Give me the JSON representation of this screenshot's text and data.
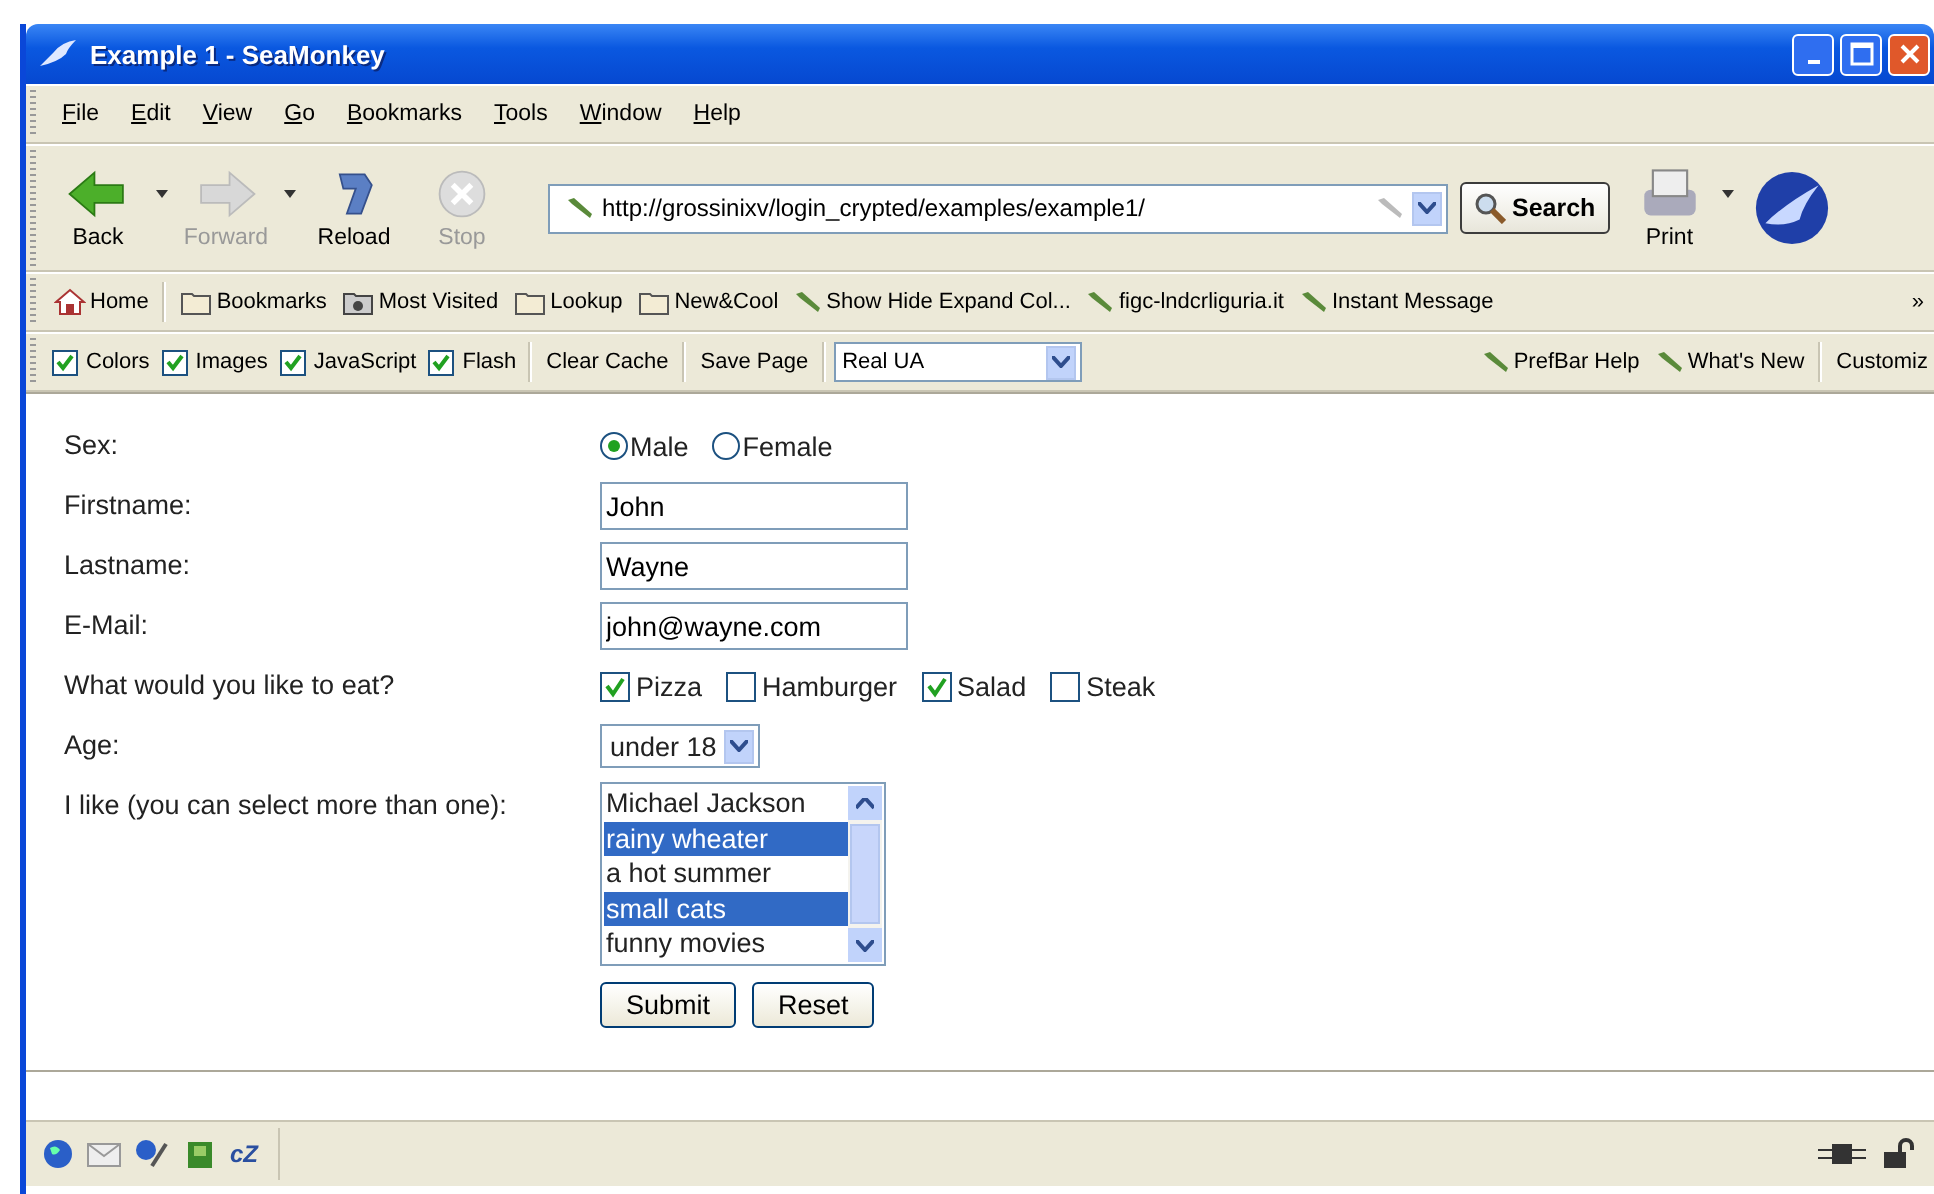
{
  "window": {
    "title": "Example 1 - SeaMonkey"
  },
  "menu": [
    "File",
    "Edit",
    "View",
    "Go",
    "Bookmarks",
    "Tools",
    "Window",
    "Help"
  ],
  "nav_buttons": [
    {
      "kind": "back",
      "label": "Back",
      "disabled": false
    },
    {
      "kind": "forward",
      "label": "Forward",
      "disabled": true
    },
    {
      "kind": "reload",
      "label": "Reload",
      "disabled": false
    },
    {
      "kind": "stop",
      "label": "Stop",
      "disabled": true
    }
  ],
  "url": "http://grossinixv/login_crypted/examples/example1/",
  "search_button": "Search",
  "print_button": "Print",
  "bookmarks": [
    {
      "kind": "home",
      "label": "Home"
    },
    {
      "kind": "folder",
      "label": "Bookmarks"
    },
    {
      "kind": "camera",
      "label": "Most Visited"
    },
    {
      "kind": "folder",
      "label": "Lookup"
    },
    {
      "kind": "folder",
      "label": "New&Cool"
    },
    {
      "kind": "link",
      "label": "Show Hide Expand Col..."
    },
    {
      "kind": "link",
      "label": "figc-lndcrliguria.it"
    },
    {
      "kind": "link",
      "label": "Instant Message"
    }
  ],
  "bookmarks_overflow": "»",
  "prefbar": {
    "checkboxes": [
      {
        "label": "Colors",
        "checked": true
      },
      {
        "label": "Images",
        "checked": true
      },
      {
        "label": "JavaScript",
        "checked": true
      },
      {
        "label": "Flash",
        "checked": true
      }
    ],
    "buttons": [
      "Clear Cache",
      "Save Page"
    ],
    "user_agent": "Real UA",
    "links": [
      "PrefBar Help",
      "What's New"
    ],
    "customize": "Customiz"
  },
  "form": {
    "sex_label": "Sex:",
    "sex_options": [
      {
        "label": "Male",
        "selected": true
      },
      {
        "label": "Female",
        "selected": false
      }
    ],
    "fields": [
      {
        "label": "Firstname:",
        "value": "John"
      },
      {
        "label": "Lastname:",
        "value": "Wayne"
      },
      {
        "label": "E-Mail:",
        "value": "john@wayne.com"
      }
    ],
    "eat_label": "What would you like to eat?",
    "eat_options": [
      {
        "label": "Pizza",
        "checked": true
      },
      {
        "label": "Hamburger",
        "checked": false
      },
      {
        "label": "Salad",
        "checked": true
      },
      {
        "label": "Steak",
        "checked": false
      }
    ],
    "age_label": "Age:",
    "age_value": "under 18",
    "likes_label": "I like (you can select more than one):",
    "likes_options": [
      {
        "label": "Michael Jackson",
        "selected": false
      },
      {
        "label": "rainy wheater",
        "selected": true
      },
      {
        "label": "a hot summer",
        "selected": false
      },
      {
        "label": "small cats",
        "selected": true
      },
      {
        "label": "funny movies",
        "selected": false
      }
    ],
    "buttons": [
      "Submit",
      "Reset"
    ]
  },
  "status_bar": {
    "chat_icon_text": "cZ"
  }
}
